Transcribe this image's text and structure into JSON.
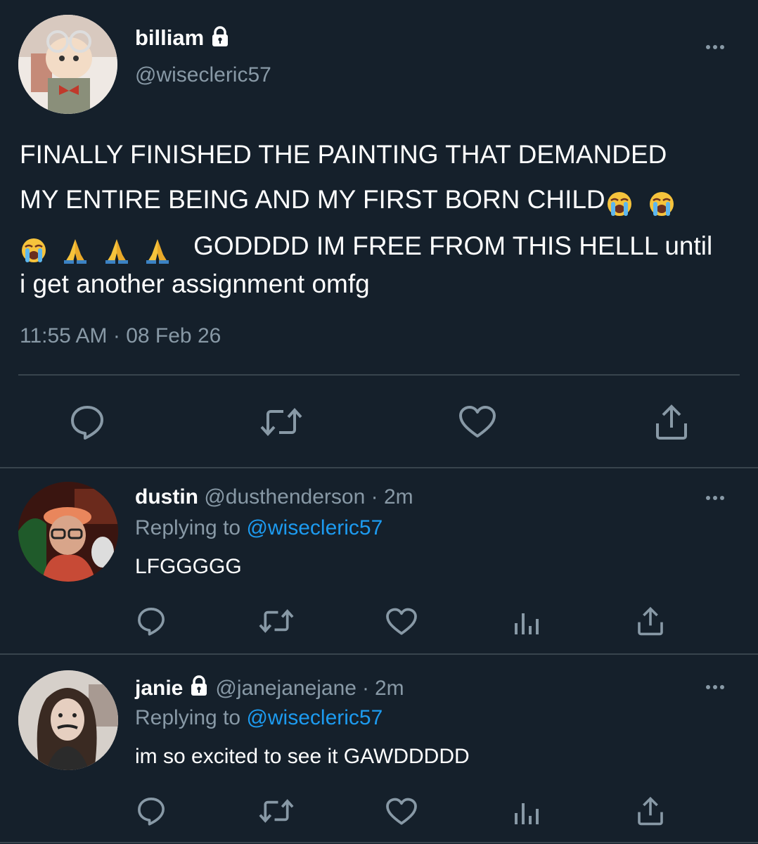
{
  "main_tweet": {
    "display_name": "billiam",
    "handle": "@wisecleric57",
    "text_line1": "FINALLY FINISHED THE PAINTING THAT DEMANDED",
    "text_line2": "MY ENTIRE BEING AND MY FIRST BORN CHILD",
    "text_line3": "GODDDD IM FREE FROM THIS HELLL until",
    "text_line4": "i get another assignment omfg",
    "time": "11:55 AM",
    "separator": "·",
    "date": "08 Feb 26",
    "protected_icon": "lock-icon"
  },
  "replies": [
    {
      "display_name": "dustin",
      "handle": "@dusthenderson",
      "separator": "·",
      "age": "2m",
      "replying_to_label": "Replying to",
      "replying_to_handle": "@wisecleric57",
      "text": "LFGGGGG"
    },
    {
      "display_name": "janie",
      "handle": "@janejanejane",
      "separator": "·",
      "age": "2m",
      "replying_to_label": "Replying to",
      "replying_to_handle": "@wisecleric57",
      "text": "im so excited to see it GAWDDDDD",
      "protected_icon": "lock-icon"
    }
  ],
  "icons": [
    "reply-icon",
    "retweet-icon",
    "like-icon",
    "analytics-icon",
    "share-icon",
    "more-icon",
    "loudly-crying-face-emoji",
    "folded-hands-emoji"
  ],
  "colors": {
    "background": "#15202b",
    "muted": "#8899a6",
    "link": "#1d9bf0",
    "divider": "#38444d"
  }
}
